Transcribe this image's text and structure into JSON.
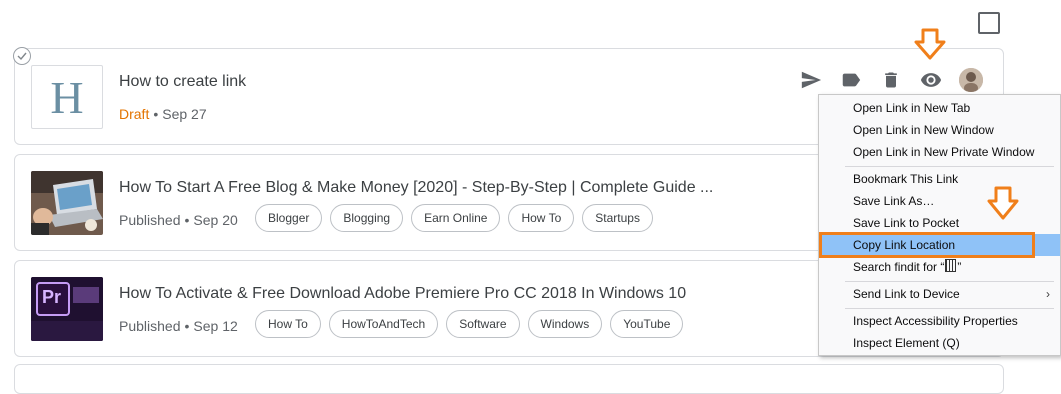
{
  "posts": [
    {
      "title": "How to create link",
      "thumb_letter": "H",
      "status": "Draft",
      "date": "Sep 27",
      "tags": []
    },
    {
      "title": "How To Start A Free Blog & Make Money [2020] - Step-By-Step | Complete Guide ...",
      "status": "Published",
      "date": "Sep 20",
      "tags": [
        "Blogger",
        "Blogging",
        "Earn Online",
        "How To",
        "Startups"
      ]
    },
    {
      "title": "How To Activate & Free Download Adobe Premiere Pro CC 2018 In Windows 10",
      "status": "Published",
      "date": "Sep 12",
      "thumb_logo": "Pr",
      "tags": [
        "How To",
        "HowToAndTech",
        "Software",
        "Windows",
        "YouTube"
      ]
    }
  ],
  "meta_separator": "•",
  "actions": [
    "send-icon",
    "label-icon",
    "delete-icon",
    "view-icon",
    "avatar"
  ],
  "context_menu": {
    "items": [
      "Open Link in New Tab",
      "Open Link in New Window",
      "Open Link in New Private Window",
      "Bookmark This Link",
      "Save Link As…",
      "Save Link to Pocket",
      "Copy Link Location",
      "Search findit for “",
      "Send Link to Device",
      "Inspect Accessibility Properties",
      "Inspect Element (Q)"
    ],
    "highlighted": "Copy Link Location",
    "search_suffix": "”",
    "submenu_arrow": "›"
  },
  "colors": {
    "draft": "#e37400",
    "highlight": "#8fc2f7",
    "callout": "#f07f1a"
  }
}
